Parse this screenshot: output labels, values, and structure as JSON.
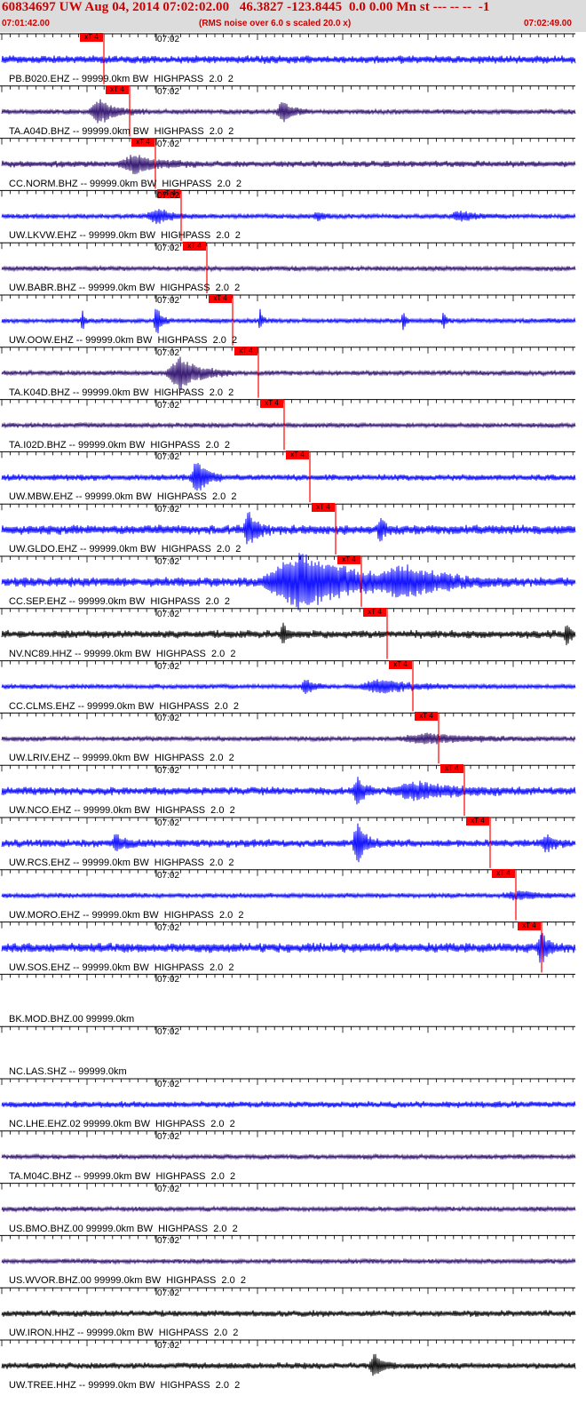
{
  "header": {
    "title": "60834697 UW Aug 04, 2014 07:02:02.00   46.3827 -123.8445  0.0 0.00 Mn st --- -- --  -1",
    "start_time": "07:01:42.00",
    "note": "(RMS noise over 6.0 s scaled 20.0 x)",
    "end_time": "07:02:49.00",
    "title_color": "#cc0000",
    "header_bg": "#dcdcdc"
  },
  "minute_label": "07:02",
  "pick_label": "xT 4",
  "colors": {
    "blue": "#0000ff",
    "purple": "#2a0a6a",
    "black": "#000000",
    "pick": "#ff0000"
  },
  "traces": [
    {
      "label": "PB.B020.EHZ -- 99999.0km BW  HIGHPASS  2.0  2",
      "color": "blue",
      "amp": 5,
      "pick": true,
      "events": []
    },
    {
      "label": "TA.A04D.BHZ -- 99999.0km BW  HIGHPASS  2.0  2",
      "color": "purple",
      "amp": 3,
      "pick": true,
      "events": [
        {
          "t": 0.17,
          "a": 14,
          "w": 0.02
        },
        {
          "t": 0.49,
          "a": 12,
          "w": 0.012
        }
      ]
    },
    {
      "label": "CC.NORM.BHZ -- 99999.0km BW  HIGHPASS  2.0  2",
      "color": "purple",
      "amp": 4,
      "pick": true,
      "events": [
        {
          "t": 0.23,
          "a": 9,
          "w": 0.03
        }
      ]
    },
    {
      "label": "UW.LKVW.EHZ -- 99999.0km BW  HIGHPASS  2.0  2",
      "color": "blue",
      "amp": 3,
      "pick": true,
      "events": [
        {
          "t": 0.27,
          "a": 8,
          "w": 0.02
        },
        {
          "t": 0.55,
          "a": 4,
          "w": 0.01
        },
        {
          "t": 0.8,
          "a": 5,
          "w": 0.02
        }
      ]
    },
    {
      "label": "UW.BABR.BHZ -- 99999.0km BW  HIGHPASS  2.0  2",
      "color": "purple",
      "amp": 3,
      "pick": true,
      "events": []
    },
    {
      "label": "UW.OOW.EHZ -- 99999.0km BW  HIGHPASS  2.0  2",
      "color": "blue",
      "amp": 3,
      "pick": true,
      "events": [
        {
          "t": 0.14,
          "a": 14,
          "w": 0.003
        },
        {
          "t": 0.27,
          "a": 18,
          "w": 0.006
        },
        {
          "t": 0.45,
          "a": 13,
          "w": 0.003
        },
        {
          "t": 0.7,
          "a": 12,
          "w": 0.003
        },
        {
          "t": 0.77,
          "a": 10,
          "w": 0.003
        }
      ]
    },
    {
      "label": "TA.K04D.BHZ -- 99999.0km BW  HIGHPASS  2.0  2",
      "color": "purple",
      "amp": 3,
      "pick": true,
      "events": [
        {
          "t": 0.31,
          "a": 18,
          "w": 0.025
        }
      ]
    },
    {
      "label": "TA.I02D.BHZ -- 99999.0km BW  HIGHPASS  2.0  2",
      "color": "purple",
      "amp": 3,
      "pick": true,
      "events": []
    },
    {
      "label": "UW.MBW.EHZ -- 99999.0km BW  HIGHPASS  2.0  2",
      "color": "blue",
      "amp": 4,
      "pick": true,
      "events": [
        {
          "t": 0.34,
          "a": 20,
          "w": 0.012
        }
      ]
    },
    {
      "label": "UW.GLDO.EHZ -- 99999.0km BW  HIGHPASS  2.0  2",
      "color": "blue",
      "amp": 6,
      "pick": true,
      "events": [
        {
          "t": 0.43,
          "a": 18,
          "w": 0.01
        },
        {
          "t": 0.66,
          "a": 12,
          "w": 0.006
        }
      ]
    },
    {
      "label": "CC.SEP.EHZ -- 99999.0km BW  HIGHPASS  2.0  2",
      "color": "blue",
      "amp": 6,
      "pick": true,
      "events": [
        {
          "t": 0.52,
          "a": 30,
          "w": 0.07
        },
        {
          "t": 0.7,
          "a": 12,
          "w": 0.05
        }
      ]
    },
    {
      "label": "NV.NC89.HHZ -- 99999.0km BW  HIGHPASS  2.0  2",
      "color": "black",
      "amp": 5,
      "pick": true,
      "events": [
        {
          "t": 0.49,
          "a": 14,
          "w": 0.005
        },
        {
          "t": 0.985,
          "a": 12,
          "w": 0.005
        }
      ]
    },
    {
      "label": "CC.CLMS.EHZ -- 99999.0km BW  HIGHPASS  2.0  2",
      "color": "blue",
      "amp": 3,
      "pick": true,
      "events": [
        {
          "t": 0.53,
          "a": 8,
          "w": 0.01
        },
        {
          "t": 0.66,
          "a": 7,
          "w": 0.04
        }
      ]
    },
    {
      "label": "UW.LRIV.EHZ -- 99999.0km BW  HIGHPASS  2.0  2",
      "color": "purple",
      "amp": 3,
      "pick": true,
      "events": [
        {
          "t": 0.74,
          "a": 5,
          "w": 0.05
        }
      ]
    },
    {
      "label": "UW.NCO.EHZ -- 99999.0km BW  HIGHPASS  2.0  2",
      "color": "blue",
      "amp": 5,
      "pick": true,
      "events": [
        {
          "t": 0.62,
          "a": 14,
          "w": 0.01
        },
        {
          "t": 0.72,
          "a": 8,
          "w": 0.05
        }
      ]
    },
    {
      "label": "UW.RCS.EHZ -- 99999.0km BW  HIGHPASS  2.0  2",
      "color": "blue",
      "amp": 5,
      "pick": true,
      "events": [
        {
          "t": 0.2,
          "a": 9,
          "w": 0.01
        },
        {
          "t": 0.62,
          "a": 22,
          "w": 0.01
        },
        {
          "t": 0.95,
          "a": 9,
          "w": 0.01
        }
      ]
    },
    {
      "label": "UW.MORO.EHZ -- 99999.0km BW  HIGHPASS  2.0  2",
      "color": "blue",
      "amp": 3,
      "pick": true,
      "events": [
        {
          "t": 0.9,
          "a": 4,
          "w": 0.03
        }
      ]
    },
    {
      "label": "UW.SOS.EHZ -- 99999.0km BW  HIGHPASS  2.0  2",
      "color": "blue",
      "amp": 6,
      "pick": true,
      "events": [
        {
          "t": 0.94,
          "a": 18,
          "w": 0.008
        }
      ]
    },
    {
      "label": "BK.MOD.BHZ.00 99999.0km",
      "color": "none",
      "amp": 0,
      "pick": false,
      "events": []
    },
    {
      "label": "NC.LAS.SHZ -- 99999.0km",
      "color": "none",
      "amp": 0,
      "pick": false,
      "events": []
    },
    {
      "label": "NC.LHE.EHZ.02 99999.0km BW  HIGHPASS  2.0  2",
      "color": "blue",
      "amp": 4,
      "pick": false,
      "events": []
    },
    {
      "label": "TA.M04C.BHZ -- 99999.0km BW  HIGHPASS  2.0  2",
      "color": "purple",
      "amp": 3,
      "pick": false,
      "events": []
    },
    {
      "label": "US.BMO.BHZ.00 99999.0km BW  HIGHPASS  2.0  2",
      "color": "purple",
      "amp": 3,
      "pick": false,
      "events": []
    },
    {
      "label": "US.WVOR.BHZ.00 99999.0km BW  HIGHPASS  2.0  2",
      "color": "purple",
      "amp": 3,
      "pick": false,
      "events": []
    },
    {
      "label": "UW.IRON.HHZ -- 99999.0km BW  HIGHPASS  2.0  2",
      "color": "black",
      "amp": 4,
      "pick": false,
      "events": []
    },
    {
      "label": "UW.TREE.HHZ -- 99999.0km BW  HIGHPASS  2.0  2",
      "color": "black",
      "amp": 4,
      "pick": false,
      "events": [
        {
          "t": 0.65,
          "a": 12,
          "w": 0.01
        }
      ]
    }
  ]
}
